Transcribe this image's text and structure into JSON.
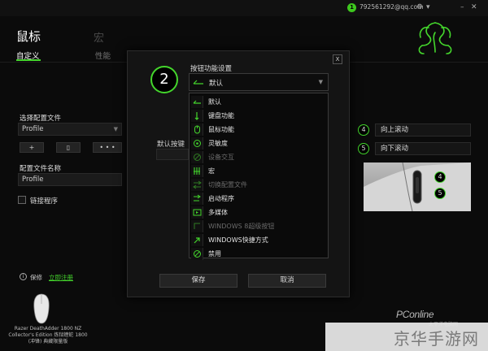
{
  "topbar": {
    "badge": "1",
    "account": "792561292@qq.com"
  },
  "header": {
    "title": "鼠标",
    "title_faded": "宏",
    "tabs": [
      {
        "label": "自定义"
      },
      {
        "label": "性能"
      }
    ]
  },
  "left": {
    "profile_select_label": "选择配置文件",
    "profile_value": "Profile",
    "btn_add": "+",
    "btn_del": "▯",
    "btn_more": "• • •",
    "profile_name_label": "配置文件名称",
    "profile_name_value": "Profile",
    "link_program": "链接程序",
    "warranty": "保修",
    "register": "立即注册",
    "device_name": "Razer DeathAdder 1800 NZ Collector's Edition 炼狱蝰蛇 1800 (冲锋) 典藏限量版"
  },
  "right": {
    "items": [
      {
        "num": "4",
        "label": "向上滚动"
      },
      {
        "num": "5",
        "label": "向下滚动"
      }
    ],
    "mouse_marks": [
      "4",
      "5"
    ]
  },
  "modal": {
    "button_number": "2",
    "title": "按钮功能设置",
    "selected": "默认",
    "default_key_label": "默认按键",
    "save": "保存",
    "cancel": "取消",
    "close": "X",
    "options": [
      {
        "label": "默认",
        "icon": "default-icon",
        "disabled": false
      },
      {
        "label": "键盘功能",
        "icon": "keyboard-function-icon",
        "disabled": false
      },
      {
        "label": "鼠标功能",
        "icon": "mouse-function-icon",
        "disabled": false
      },
      {
        "label": "灵敏度",
        "icon": "sensitivity-icon",
        "disabled": false
      },
      {
        "label": "设备交互",
        "icon": "inter-device-icon",
        "disabled": true
      },
      {
        "label": "宏",
        "icon": "macro-icon",
        "disabled": false
      },
      {
        "label": "切换配置文件",
        "icon": "switch-profile-icon",
        "disabled": true
      },
      {
        "label": "启动程序",
        "icon": "launch-program-icon",
        "disabled": false
      },
      {
        "label": "多媒体",
        "icon": "multimedia-icon",
        "disabled": false
      },
      {
        "label": "WINDOWS 8超级按钮",
        "icon": "windows8-charms-icon",
        "disabled": true
      },
      {
        "label": "WINDOWS快捷方式",
        "icon": "windows-shortcut-icon",
        "disabled": false
      },
      {
        "label": "禁用",
        "icon": "disable-icon",
        "disabled": false
      }
    ]
  },
  "watermark": {
    "brand": "PConline",
    "brand_sub": "太平洋电脑网",
    "site": "京华手游网"
  },
  "colors": {
    "accent": "#44d62c",
    "background": "#0b0b0b"
  }
}
